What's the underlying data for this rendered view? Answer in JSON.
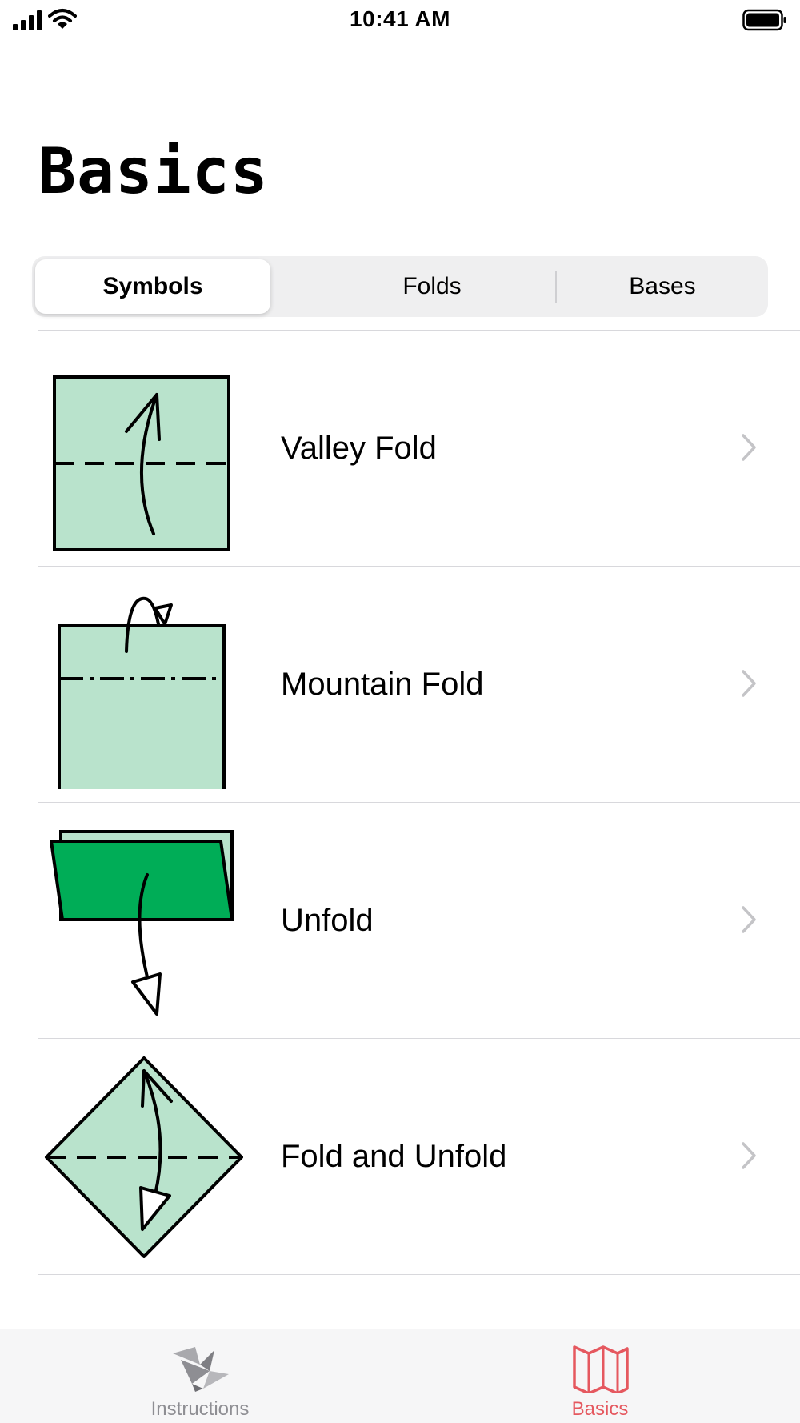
{
  "status_bar": {
    "time": "10:41 AM",
    "icons": [
      "cellular-signal-icon",
      "wifi-icon",
      "battery-icon"
    ]
  },
  "page": {
    "title": "Basics"
  },
  "segmented_control": {
    "segments": [
      "Symbols",
      "Folds",
      "Bases"
    ],
    "selected": "Symbols"
  },
  "list": {
    "items": [
      {
        "label": "Valley Fold",
        "icon": "valley-fold-icon"
      },
      {
        "label": "Mountain Fold",
        "icon": "mountain-fold-icon"
      },
      {
        "label": "Unfold",
        "icon": "unfold-icon"
      },
      {
        "label": "Fold and Unfold",
        "icon": "fold-and-unfold-icon"
      }
    ]
  },
  "tab_bar": {
    "tabs": [
      {
        "label": "Instructions",
        "icon": "origami-crane-icon",
        "active": false
      },
      {
        "label": "Basics",
        "icon": "map-book-icon",
        "active": true
      }
    ]
  },
  "colors": {
    "accent": "#e5585f",
    "paper_light": "#b9e3cc",
    "paper_dark": "#00ad57",
    "inactive_tab": "#8e8e93"
  }
}
